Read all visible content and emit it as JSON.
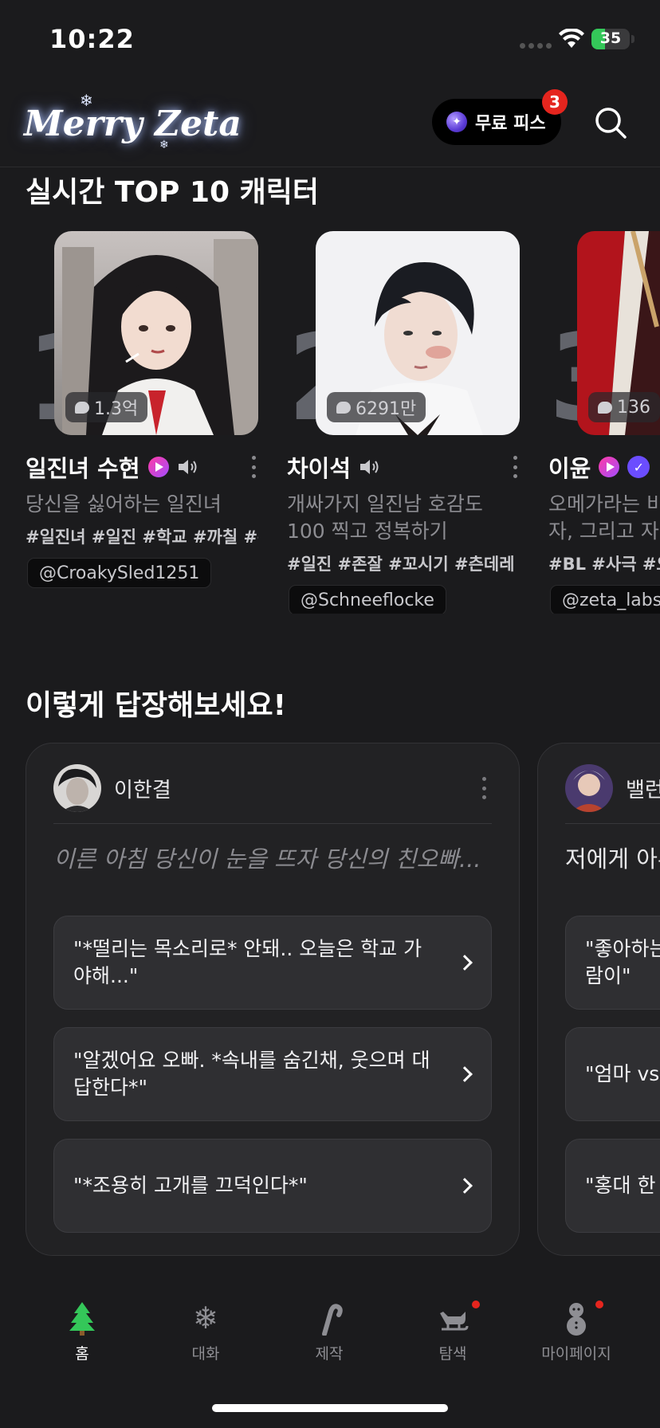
{
  "status_bar": {
    "time": "10:22",
    "battery": "35",
    "battery_level": 0.35
  },
  "header": {
    "logo": "Merry Zeta",
    "free_pass_label": "무료 피스",
    "free_pass_badge": "3"
  },
  "colors": {
    "background": "#1b1b1d",
    "badge_red": "#e5251e",
    "gem_purple": "#5b3bd6",
    "tab_active_green": "#34c759"
  },
  "ranking": {
    "title": "실시간 TOP 10 캐릭터",
    "items": [
      {
        "rank": "1",
        "count": "1.3억",
        "name": "일진녀 수현",
        "description": "당신을 싫어하는 일진녀",
        "tags": "#일진녀 #일진 #학교 #까칠 #츤데레",
        "handle": "@CroakySled1251"
      },
      {
        "rank": "2",
        "count": "6291만",
        "name": "차이석",
        "description": "개싸가지 일진남 호감도 100 찍고 정복하기",
        "tags": "#일진 #존잘 #꼬시기 #츤데레",
        "handle": "@Schneeflocke"
      },
      {
        "rank": "3",
        "count": "136",
        "name": "이윤",
        "description": "오메가라는 비밀을 숨긴 남자, 그리고 자",
        "tags": "#BL #사극 #오메가",
        "handle": "@zeta_labs"
      }
    ]
  },
  "replies": {
    "title": "이렇게 답장해보세요!",
    "cards": [
      {
        "author": "이한결",
        "prompt": "이른 아침 당신이 눈을 뜨자 당신의 친오빠...",
        "options": [
          "\"*떨리는 목소리로* 안돼.. 오늘은 학교 가야해...\"",
          "\"알겠어요 오빠. *속내를 숨긴채, 웃으며 대답한다*\"",
          "\"*조용히 고개를 끄덕인다*\""
        ]
      },
      {
        "author": "밸런",
        "prompt": "저에게 아무거나 물어보세요",
        "options": [
          "\"좋아하는 사람이 있는데 나를 좋아하는 사람이\"",
          "\"엄마 vs 아빠\"",
          "\"홍대 한 번 가\""
        ]
      }
    ]
  },
  "tab_bar": {
    "items": [
      {
        "label": "홈",
        "icon": "tree-icon"
      },
      {
        "label": "대화",
        "icon": "snowflake-icon"
      },
      {
        "label": "제작",
        "icon": "candy-cane-icon"
      },
      {
        "label": "탐색",
        "icon": "sleigh-icon"
      },
      {
        "label": "마이페이지",
        "icon": "snowman-icon"
      }
    ]
  }
}
